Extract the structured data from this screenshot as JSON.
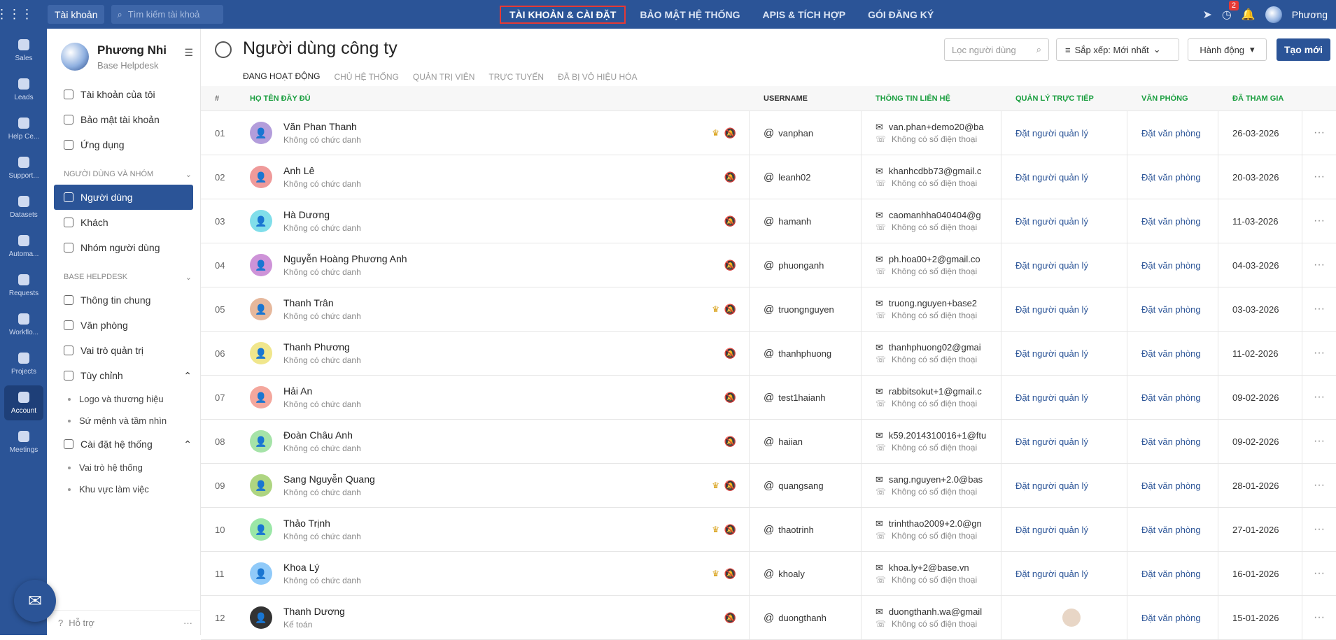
{
  "topbar": {
    "account_label": "Tài khoản",
    "search_placeholder": "Tìm kiếm tài khoả",
    "nav": [
      {
        "label": "TÀI KHOẢN & CÀI ĐẶT",
        "active": true
      },
      {
        "label": "BẢO MẬT HỆ THỐNG",
        "active": false
      },
      {
        "label": "APIS & TÍCH HỢP",
        "active": false
      },
      {
        "label": "GÓI ĐĂNG KÝ",
        "active": false
      }
    ],
    "notif_count": "2",
    "user_name": "Phương"
  },
  "rail": [
    {
      "label": "Sales"
    },
    {
      "label": "Leads"
    },
    {
      "label": "Help Ce..."
    },
    {
      "label": "Support..."
    },
    {
      "label": "Datasets"
    },
    {
      "label": "Automa..."
    },
    {
      "label": "Requests"
    },
    {
      "label": "Workflo..."
    },
    {
      "label": "Projects"
    },
    {
      "label": "Account"
    },
    {
      "label": "Meetings"
    }
  ],
  "sidebar": {
    "profile_name": "Phương Nhi",
    "profile_sub": "Base Helpdesk",
    "top_items": [
      "Tài khoản của tôi",
      "Bảo mật tài khoản",
      "Ứng dụng"
    ],
    "group1_title": "NGƯỜI DÙNG VÀ NHÓM",
    "group1_items": [
      "Người dùng",
      "Khách",
      "Nhóm người dùng"
    ],
    "group2_title": "BASE HELPDESK",
    "group2_items": [
      "Thông tin chung",
      "Văn phòng",
      "Vai trò quản trị"
    ],
    "custom_label": "Tùy chỉnh",
    "custom_subs": [
      "Logo và thương hiệu",
      "Sứ mệnh và tầm nhìn"
    ],
    "sys_label": "Cài đặt hệ thống",
    "sys_subs": [
      "Vai trò hệ thống",
      "Khu vực làm việc"
    ],
    "help_label": "Hỗ trợ"
  },
  "main": {
    "title": "Người dùng công ty",
    "tabs": [
      "ĐANG HOẠT ĐỘNG",
      "CHỦ HỆ THỐNG",
      "QUẢN TRỊ VIÊN",
      "TRỰC TUYẾN",
      "ĐÃ BỊ VÔ HIỆU HÓA"
    ],
    "filter_placeholder": "Lọc người dùng",
    "sort_label": "Sắp xếp: Mới nhất",
    "action_label": "Hành động",
    "create_label": "Tạo mới"
  },
  "table": {
    "headers": [
      "#",
      "HỌ TÊN ĐẦY ĐỦ",
      "USERNAME",
      "THÔNG TIN LIÊN HỆ",
      "QUẢN LÝ TRỰC TIẾP",
      "VĂN PHÒNG",
      "ĐÃ THAM GIA"
    ],
    "rows": [
      {
        "num": "01",
        "name": "Văn Phan Thanh",
        "title": "Không có chức danh",
        "username": "vanphan",
        "email": "van.phan+demo20@ba",
        "phone": "Không có số điện thoại",
        "manager": "Đặt người quản lý",
        "office": "Đặt văn phòng",
        "joined": "26-03-2026",
        "avatar_color": "#b39ddb",
        "crown": true
      },
      {
        "num": "02",
        "name": "Anh Lê",
        "title": "Không có chức danh",
        "username": "leanh02",
        "email": "khanhcdbb73@gmail.c",
        "phone": "Không có số điện thoại",
        "manager": "Đặt người quản lý",
        "office": "Đặt văn phòng",
        "joined": "20-03-2026",
        "avatar_color": "#ef9a9a",
        "crown": false
      },
      {
        "num": "03",
        "name": "Hà Dương",
        "title": "Không có chức danh",
        "username": "hamanh",
        "email": "caomanhha040404@g",
        "phone": "Không có số điện thoại",
        "manager": "Đặt người quản lý",
        "office": "Đặt văn phòng",
        "joined": "11-03-2026",
        "avatar_color": "#80deea",
        "crown": false
      },
      {
        "num": "04",
        "name": "Nguyễn Hoàng Phương Anh",
        "title": "Không có chức danh",
        "username": "phuonganh",
        "email": "ph.hoa00+2@gmail.co",
        "phone": "Không có số điện thoại",
        "manager": "Đặt người quản lý",
        "office": "Đặt văn phòng",
        "joined": "04-03-2026",
        "avatar_color": "#ce93d8",
        "crown": false
      },
      {
        "num": "05",
        "name": "Thanh Trân",
        "title": "Không có chức danh",
        "username": "truongnguyen",
        "email": "truong.nguyen+base2",
        "phone": "Không có số điện thoại",
        "manager": "Đặt người quản lý",
        "office": "Đặt văn phòng",
        "joined": "03-03-2026",
        "avatar_color": "#e6b89c",
        "crown": true
      },
      {
        "num": "06",
        "name": "Thanh Phương",
        "title": "Không có chức danh",
        "username": "thanhphuong",
        "email": "thanhphuong02@gmai",
        "phone": "Không có số điện thoại",
        "manager": "Đặt người quản lý",
        "office": "Đặt văn phòng",
        "joined": "11-02-2026",
        "avatar_color": "#f0e68c",
        "crown": false
      },
      {
        "num": "07",
        "name": "Hải An",
        "title": "Không có chức danh",
        "username": "test1haianh",
        "email": "rabbitsokut+1@gmail.c",
        "phone": "Không có số điện thoại",
        "manager": "Đặt người quản lý",
        "office": "Đặt văn phòng",
        "joined": "09-02-2026",
        "avatar_color": "#f4a79d",
        "crown": false
      },
      {
        "num": "08",
        "name": "Đoàn Châu Anh",
        "title": "Không có chức danh",
        "username": "haiian",
        "email": "k59.2014310016+1@ftu",
        "phone": "Không có số điện thoại",
        "manager": "Đặt người quản lý",
        "office": "Đặt văn phòng",
        "joined": "09-02-2026",
        "avatar_color": "#a5e3a8",
        "crown": false
      },
      {
        "num": "09",
        "name": "Sang Nguyễn Quang",
        "title": "Không có chức danh",
        "username": "quangsang",
        "email": "sang.nguyen+2.0@bas",
        "phone": "Không có số điện thoại",
        "manager": "Đặt người quản lý",
        "office": "Đặt văn phòng",
        "joined": "28-01-2026",
        "avatar_color": "#aed581",
        "crown": true
      },
      {
        "num": "10",
        "name": "Thảo Trịnh",
        "title": "Không có chức danh",
        "username": "thaotrinh",
        "email": "trinhthao2009+2.0@gn",
        "phone": "Không có số điện thoại",
        "manager": "Đặt người quản lý",
        "office": "Đặt văn phòng",
        "joined": "27-01-2026",
        "avatar_color": "#9be7a7",
        "crown": true
      },
      {
        "num": "11",
        "name": "Khoa Lý",
        "title": "Không có chức danh",
        "username": "khoaly",
        "email": "khoa.ly+2@base.vn",
        "phone": "Không có số điện thoại",
        "manager": "Đặt người quản lý",
        "office": "Đặt văn phòng",
        "joined": "16-01-2026",
        "avatar_color": "#90caf9",
        "crown": true
      },
      {
        "num": "12",
        "name": "Thanh Dương",
        "title": "Kế toán",
        "username": "duongthanh",
        "email": "duongthanh.wa@gmail",
        "phone": "Không có số điện thoại",
        "manager": "",
        "office": "Đặt văn phòng",
        "joined": "15-01-2026",
        "avatar_color": "#333333",
        "crown": false
      }
    ]
  }
}
